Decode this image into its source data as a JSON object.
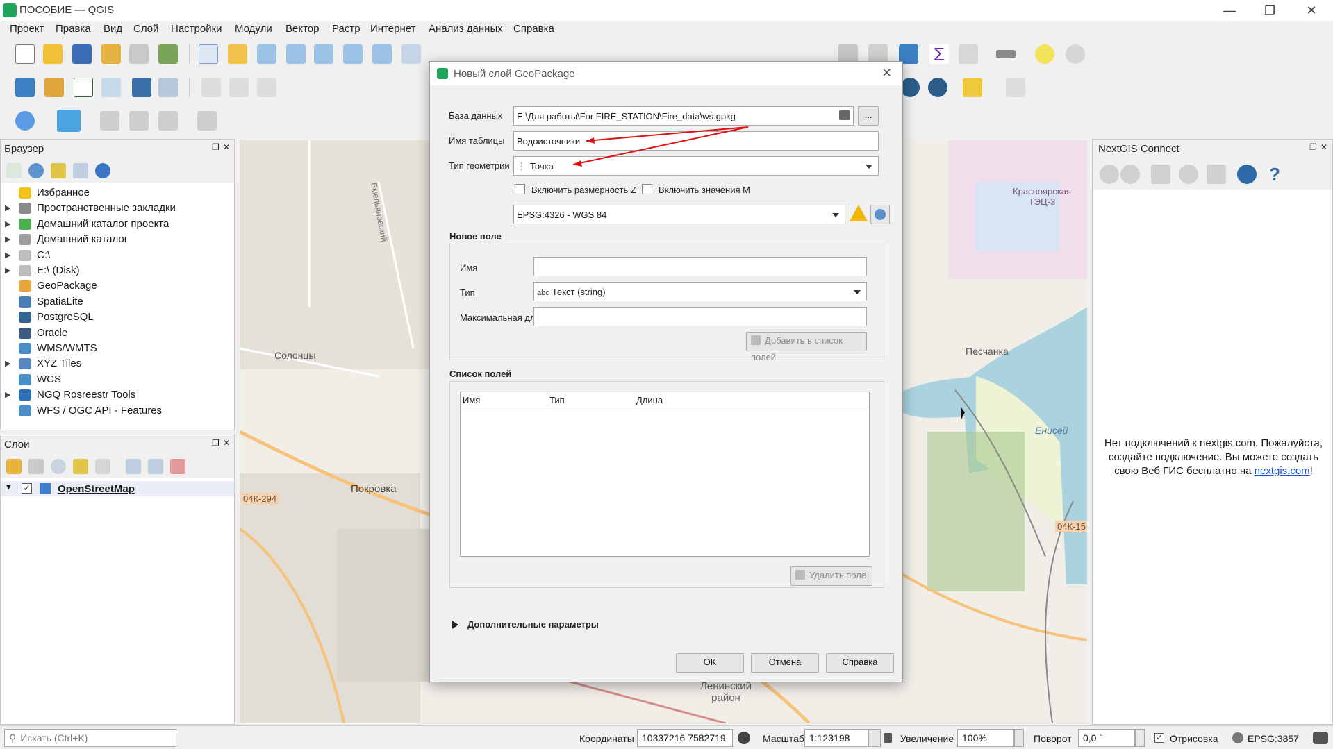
{
  "window": {
    "title": "ПОСОБИЕ — QGIS"
  },
  "menu": [
    "Проект",
    "Правка",
    "Вид",
    "Слой",
    "Настройки",
    "Модули",
    "Вектор",
    "Растр",
    "Интернет",
    "Анализ данных",
    "Справка"
  ],
  "browser": {
    "title": "Браузер",
    "items": [
      {
        "label": "Избранное",
        "expandable": false,
        "icon": "star-icon",
        "color": "#f2c21b"
      },
      {
        "label": "Пространственные закладки",
        "expandable": true,
        "icon": "bookmarks-icon",
        "color": "#8a8a8a"
      },
      {
        "label": "Домашний каталог проекта",
        "expandable": true,
        "icon": "project-home-icon",
        "color": "#4caf50"
      },
      {
        "label": "Домашний каталог",
        "expandable": true,
        "icon": "home-folder-icon",
        "color": "#9e9e9e"
      },
      {
        "label": "C:\\",
        "expandable": true,
        "icon": "folder-icon",
        "color": "#bdbdbd"
      },
      {
        "label": "E:\\ (Disk)",
        "expandable": true,
        "icon": "folder-icon",
        "color": "#bdbdbd"
      },
      {
        "label": "GeoPackage",
        "expandable": false,
        "icon": "geopackage-icon",
        "color": "#e8a33a"
      },
      {
        "label": "SpatiaLite",
        "expandable": false,
        "icon": "spatialite-icon",
        "color": "#4a7fb5"
      },
      {
        "label": "PostgreSQL",
        "expandable": false,
        "icon": "postgresql-icon",
        "color": "#336791"
      },
      {
        "label": "Oracle",
        "expandable": false,
        "icon": "oracle-icon",
        "color": "#3d5a80"
      },
      {
        "label": "WMS/WMTS",
        "expandable": false,
        "icon": "wms-icon",
        "color": "#4a8fc7"
      },
      {
        "label": "XYZ Tiles",
        "expandable": true,
        "icon": "xyz-tiles-icon",
        "color": "#5b87c5"
      },
      {
        "label": "WCS",
        "expandable": false,
        "icon": "wcs-icon",
        "color": "#4a8fc7"
      },
      {
        "label": "NGQ Rosreestr Tools",
        "expandable": true,
        "icon": "rosreestr-icon",
        "color": "#2d6fb7"
      },
      {
        "label": "WFS / OGC API - Features",
        "expandable": false,
        "icon": "wfs-icon",
        "color": "#4a8fc7"
      }
    ]
  },
  "layers": {
    "title": "Слои",
    "items": [
      {
        "label": "OpenStreetMap",
        "checked": true
      }
    ]
  },
  "map": {
    "labels": [
      "Солонцы",
      "Покровка",
      "Песчанка",
      "Енисей",
      "Красноярская ТЭЦ-3",
      "04К-294",
      "04К-15",
      "Ленинский район",
      "Емельяновский"
    ]
  },
  "nextgis": {
    "title": "NextGIS Connect",
    "message_part1": "Нет подключений к nextgis.com. Пожалуйста, создайте подключение. Вы можете создать свою Веб ГИС бесплатно на ",
    "link": "nextgis.com",
    "message_part2": "!"
  },
  "dialog": {
    "title": "Новый слой GeoPackage",
    "database_label": "База данных",
    "database_value": "E:\\Для работы\\For FIRE_STATION\\Fire_data\\ws.gpkg",
    "browse_label": "...",
    "table_label": "Имя таблицы",
    "table_value": "Водоисточники",
    "geometry_label": "Тип геометрии",
    "geometry_value": "Точка",
    "z_label": "Включить размерность Z",
    "m_label": "Включить значения M",
    "crs_value": "EPSG:4326 - WGS 84",
    "new_field_title": "Новое поле",
    "name_label": "Имя",
    "name_value": "",
    "type_label": "Тип",
    "type_prefix": "abc",
    "type_value": "Текст (string)",
    "maxlen_label": "Максимальная длина",
    "maxlen_value": "",
    "add_button": "Добавить в список полей",
    "fields_title": "Список полей",
    "columns": [
      "Имя",
      "Тип",
      "Длина"
    ],
    "delete_button": "Удалить поле",
    "advanced_label": "Дополнительные параметры",
    "ok": "OK",
    "cancel": "Отмена",
    "help": "Справка"
  },
  "status": {
    "search_placeholder": "Искать (Ctrl+K)",
    "coords_label": "Координаты",
    "coords_value": "10337216  7582719",
    "scale_label": "Масштаб",
    "scale_value": "1:123198",
    "magnifier_label": "Увеличение",
    "magnifier_value": "100%",
    "rotation_label": "Поворот",
    "rotation_value": "0,0 °",
    "render_label": "Отрисовка",
    "crs": "EPSG:3857"
  }
}
